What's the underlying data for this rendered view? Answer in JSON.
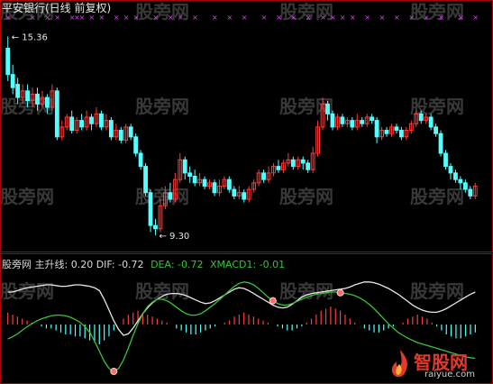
{
  "chart_data": {
    "type": "candlestick+indicator",
    "title": "平安银行(日线 前复权)",
    "price_panel": {
      "ylim": [
        9.0,
        15.7
      ],
      "high_label": "15.36",
      "low_label": "9.30",
      "candles": [
        [
          15.0,
          14.2,
          15.36,
          14.0
        ],
        [
          14.2,
          13.8,
          14.5,
          13.6
        ],
        [
          13.9,
          13.5,
          14.1,
          13.3
        ],
        [
          13.5,
          13.7,
          13.9,
          13.3
        ],
        [
          13.7,
          13.4,
          13.9,
          13.2
        ],
        [
          13.4,
          13.6,
          13.8,
          13.2
        ],
        [
          13.6,
          13.3,
          13.8,
          13.1
        ],
        [
          13.3,
          13.5,
          13.7,
          13.2
        ],
        [
          13.5,
          13.2,
          13.6,
          13.0
        ],
        [
          13.2,
          13.7,
          13.9,
          13.1
        ],
        [
          13.7,
          12.3,
          13.8,
          12.2
        ],
        [
          12.3,
          12.6,
          12.8,
          12.2
        ],
        [
          12.6,
          12.9,
          13.0,
          12.5
        ],
        [
          12.9,
          12.5,
          13.1,
          12.4
        ],
        [
          12.5,
          12.8,
          12.9,
          12.4
        ],
        [
          12.8,
          12.6,
          13.0,
          12.5
        ],
        [
          12.6,
          12.9,
          13.1,
          12.5
        ],
        [
          12.9,
          12.7,
          13.0,
          12.5
        ],
        [
          12.7,
          13.0,
          13.2,
          12.6
        ],
        [
          13.0,
          12.6,
          13.1,
          12.5
        ],
        [
          12.6,
          12.8,
          13.0,
          12.5
        ],
        [
          12.8,
          12.3,
          12.9,
          12.2
        ],
        [
          12.3,
          12.5,
          12.7,
          12.2
        ],
        [
          12.5,
          12.2,
          12.6,
          12.1
        ],
        [
          12.2,
          12.6,
          12.7,
          12.1
        ],
        [
          12.6,
          12.3,
          12.7,
          12.2
        ],
        [
          12.3,
          11.8,
          12.4,
          11.7
        ],
        [
          11.8,
          11.4,
          11.9,
          11.3
        ],
        [
          11.4,
          10.6,
          11.5,
          10.5
        ],
        [
          10.6,
          9.6,
          10.7,
          9.4
        ],
        [
          9.6,
          9.5,
          9.8,
          9.3
        ],
        [
          9.5,
          10.2,
          10.4,
          9.4
        ],
        [
          10.2,
          10.6,
          10.8,
          10.1
        ],
        [
          10.6,
          10.4,
          10.9,
          10.3
        ],
        [
          10.4,
          11.0,
          11.2,
          10.3
        ],
        [
          11.0,
          11.6,
          11.8,
          10.9
        ],
        [
          11.6,
          11.2,
          11.7,
          11.0
        ],
        [
          11.2,
          11.1,
          11.4,
          10.9
        ],
        [
          11.1,
          10.9,
          11.3,
          10.8
        ],
        [
          10.9,
          11.0,
          11.2,
          10.8
        ],
        [
          11.0,
          10.8,
          11.1,
          10.7
        ],
        [
          10.8,
          10.9,
          11.0,
          10.7
        ],
        [
          10.9,
          10.6,
          11.0,
          10.5
        ],
        [
          10.6,
          10.8,
          11.0,
          10.5
        ],
        [
          10.8,
          11.0,
          11.1,
          10.7
        ],
        [
          11.0,
          10.7,
          11.1,
          10.6
        ],
        [
          10.7,
          10.5,
          10.8,
          10.4
        ],
        [
          10.5,
          10.6,
          10.8,
          10.4
        ],
        [
          10.6,
          10.4,
          10.7,
          10.3
        ],
        [
          10.4,
          10.7,
          10.8,
          10.3
        ],
        [
          10.7,
          10.9,
          11.0,
          10.6
        ],
        [
          10.9,
          11.2,
          11.3,
          10.8
        ],
        [
          11.2,
          11.0,
          11.3,
          10.9
        ],
        [
          11.0,
          11.2,
          11.4,
          10.9
        ],
        [
          11.2,
          11.4,
          11.5,
          11.1
        ],
        [
          11.4,
          11.3,
          11.6,
          11.2
        ],
        [
          11.3,
          11.5,
          11.6,
          11.2
        ],
        [
          11.5,
          11.6,
          11.8,
          11.4
        ],
        [
          11.6,
          11.4,
          11.7,
          11.3
        ],
        [
          11.4,
          11.6,
          11.7,
          11.3
        ],
        [
          11.6,
          11.5,
          11.7,
          11.3
        ],
        [
          11.5,
          11.3,
          11.6,
          11.2
        ],
        [
          11.3,
          11.8,
          12.0,
          11.2
        ],
        [
          11.8,
          12.6,
          12.8,
          11.7
        ],
        [
          12.6,
          13.3,
          13.5,
          12.5
        ],
        [
          13.3,
          13.0,
          13.4,
          12.8
        ],
        [
          13.0,
          12.6,
          13.1,
          12.5
        ],
        [
          12.6,
          12.9,
          13.0,
          12.5
        ],
        [
          12.9,
          12.7,
          13.0,
          12.6
        ],
        [
          12.7,
          12.8,
          12.9,
          12.6
        ],
        [
          12.8,
          12.6,
          12.9,
          12.5
        ],
        [
          12.6,
          12.8,
          13.0,
          12.5
        ],
        [
          12.8,
          12.7,
          12.9,
          12.6
        ],
        [
          12.7,
          12.9,
          13.0,
          12.6
        ],
        [
          12.9,
          12.8,
          13.0,
          12.7
        ],
        [
          12.8,
          12.3,
          12.9,
          12.1
        ],
        [
          12.3,
          12.5,
          12.6,
          12.2
        ],
        [
          12.5,
          12.4,
          12.6,
          12.3
        ],
        [
          12.4,
          12.6,
          12.7,
          12.3
        ],
        [
          12.6,
          12.5,
          12.7,
          12.4
        ],
        [
          12.5,
          12.3,
          12.6,
          12.2
        ],
        [
          12.3,
          12.5,
          12.6,
          12.2
        ],
        [
          12.5,
          12.7,
          12.8,
          12.4
        ],
        [
          12.7,
          13.0,
          13.1,
          12.6
        ],
        [
          13.0,
          12.8,
          13.1,
          12.7
        ],
        [
          12.8,
          12.9,
          13.0,
          12.7
        ],
        [
          12.9,
          12.6,
          13.0,
          12.5
        ],
        [
          12.6,
          12.4,
          12.7,
          12.3
        ],
        [
          12.4,
          11.8,
          12.5,
          11.7
        ],
        [
          11.8,
          11.4,
          11.9,
          11.3
        ],
        [
          11.4,
          11.2,
          11.5,
          11.0
        ],
        [
          11.2,
          11.0,
          11.3,
          10.9
        ],
        [
          11.0,
          10.9,
          11.1,
          10.7
        ],
        [
          10.9,
          10.7,
          11.0,
          10.6
        ],
        [
          10.7,
          10.5,
          10.8,
          10.4
        ],
        [
          10.5,
          10.8,
          10.9,
          10.4
        ]
      ],
      "top_markers": "magenta x-marks along the top of the price panel"
    },
    "indicator_panel": {
      "legend": [
        {
          "label": "股旁网 主升线: 0.20",
          "color": "#d9d9d9"
        },
        {
          "label": "DIF: -0.72",
          "color": "#d9d9d9"
        },
        {
          "label": "DEA: -0.72",
          "color": "#39c13a"
        },
        {
          "label": "XMACD1: -0.01",
          "color": "#39c13a"
        }
      ],
      "series_white": [
        0.2,
        0.2,
        0.22,
        0.24,
        0.26,
        0.27,
        0.28,
        0.29,
        0.3,
        0.3,
        0.29,
        0.28,
        0.28,
        0.29,
        0.3,
        0.3,
        0.29,
        0.28,
        0.26,
        0.22,
        0.1,
        -0.05,
        -0.2,
        -0.32,
        -0.4,
        -0.38,
        -0.3,
        -0.2,
        -0.1,
        -0.02,
        0.05,
        0.1,
        0.14,
        0.17,
        0.18,
        0.18,
        0.17,
        0.15,
        0.12,
        0.09,
        0.06,
        0.04,
        0.05,
        0.08,
        0.12,
        0.16,
        0.2,
        0.24,
        0.26,
        0.25,
        0.22,
        0.18,
        0.14,
        0.1,
        0.06,
        0.02,
        -0.01,
        -0.02,
        -0.01,
        0.03,
        0.08,
        0.13,
        0.16,
        0.18,
        0.19,
        0.2,
        0.21,
        0.22,
        0.23,
        0.24,
        0.25,
        0.27,
        0.3,
        0.32,
        0.34,
        0.34,
        0.33,
        0.31,
        0.28,
        0.25,
        0.21,
        0.17,
        0.12,
        0.07,
        0.02,
        -0.02,
        -0.05,
        -0.07,
        -0.08,
        -0.08,
        -0.06,
        -0.03,
        0.01,
        0.05,
        0.09,
        0.13,
        0.17,
        0.2
      ],
      "series_green": [
        -0.45,
        -0.42,
        -0.38,
        -0.33,
        -0.28,
        -0.24,
        -0.2,
        -0.17,
        -0.15,
        -0.13,
        -0.12,
        -0.12,
        -0.13,
        -0.15,
        -0.18,
        -0.22,
        -0.28,
        -0.36,
        -0.48,
        -0.62,
        -0.76,
        -0.86,
        -0.9,
        -0.86,
        -0.74,
        -0.58,
        -0.4,
        -0.24,
        -0.1,
        0.0,
        0.06,
        0.1,
        0.1,
        0.08,
        0.04,
        -0.01,
        -0.06,
        -0.1,
        -0.12,
        -0.12,
        -0.1,
        -0.06,
        -0.01,
        0.04,
        0.1,
        0.16,
        0.22,
        0.28,
        0.32,
        0.34,
        0.33,
        0.3,
        0.25,
        0.19,
        0.13,
        0.08,
        0.04,
        0.02,
        0.02,
        0.04,
        0.07,
        0.1,
        0.13,
        0.15,
        0.17,
        0.18,
        0.19,
        0.2,
        0.2,
        0.19,
        0.18,
        0.17,
        0.15,
        0.12,
        0.08,
        0.03,
        -0.03,
        -0.1,
        -0.17,
        -0.24,
        -0.3,
        -0.36,
        -0.4,
        -0.44,
        -0.47,
        -0.5,
        -0.52,
        -0.54,
        -0.56,
        -0.58,
        -0.6,
        -0.62,
        -0.64,
        -0.66,
        -0.68,
        -0.7,
        -0.71,
        -0.72
      ],
      "histogram": [
        0.06,
        0.05,
        0.04,
        0.03,
        0.02,
        0.01,
        0.0,
        -0.01,
        -0.02,
        -0.02,
        -0.03,
        -0.04,
        -0.05,
        -0.05,
        -0.06,
        -0.06,
        -0.07,
        -0.08,
        -0.09,
        -0.1,
        -0.08,
        -0.06,
        -0.03,
        0.0,
        0.03,
        0.05,
        0.06,
        0.07,
        0.06,
        0.05,
        0.04,
        0.03,
        0.02,
        0.01,
        0.0,
        -0.02,
        -0.03,
        -0.04,
        -0.05,
        -0.05,
        -0.04,
        -0.03,
        -0.02,
        -0.01,
        0.0,
        0.01,
        0.02,
        0.04,
        0.05,
        0.06,
        0.05,
        0.04,
        0.03,
        0.02,
        0.01,
        0.0,
        -0.01,
        -0.02,
        -0.03,
        -0.03,
        -0.02,
        -0.01,
        0.01,
        0.03,
        0.05,
        0.07,
        0.08,
        0.09,
        0.08,
        0.07,
        0.05,
        0.03,
        0.01,
        0.0,
        -0.02,
        -0.03,
        -0.04,
        -0.04,
        -0.03,
        -0.02,
        -0.01,
        0.0,
        0.01,
        0.03,
        0.04,
        0.05,
        0.04,
        0.03,
        0.01,
        -0.01,
        -0.03,
        -0.05,
        -0.06,
        -0.07,
        -0.07,
        -0.06,
        -0.05,
        -0.04
      ],
      "signal_markers": [
        22,
        55,
        69
      ],
      "ylim": [
        -1.0,
        0.5
      ]
    }
  },
  "watermark_text": "股旁网",
  "logo": {
    "name": "智股网",
    "url_text": "raiyue.com"
  },
  "colors": {
    "up": "#ff3b3b",
    "down": "#54ffff",
    "axis": "#b00000",
    "marker": "#d24de6",
    "white_line": "#e8e8e8",
    "green_line": "#39c13a"
  }
}
